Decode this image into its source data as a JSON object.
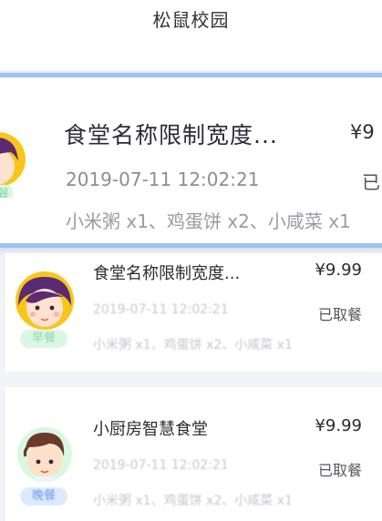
{
  "header": {
    "title": "松鼠校园"
  },
  "zoomed_order": {
    "canteen": "食堂名称限制宽度...",
    "price": "¥9",
    "time": "2019-07-11 12:02:21",
    "status": "已",
    "items": "小米粥 x1、鸡蛋饼 x2、小咸菜 x1"
  },
  "orders": [
    {
      "canteen": "食堂名称限制宽度...",
      "price": "¥9.99",
      "time": "2019-07-11 12:02:21",
      "status": "已取餐",
      "items": "小米粥 x1、鸡蛋饼 x2、小咸菜 x1",
      "meal": "早餐",
      "avatar": "girl-avatar-icon"
    },
    {
      "canteen": "小厨房智慧食堂",
      "price": "¥9.99",
      "time": "2019-07-11 12:02:21",
      "status": "已取餐",
      "items": "小米粥 x1、鸡蛋饼 x2、小咸菜 x1",
      "meal": "晚餐",
      "avatar": "boy-avatar-icon"
    }
  ],
  "colors": {
    "accent": "#9fc3f2",
    "breakfast_badge": "#d9f7e4",
    "dinner_badge": "#dde9ff",
    "avatar_yellow": "#f8c61a"
  }
}
